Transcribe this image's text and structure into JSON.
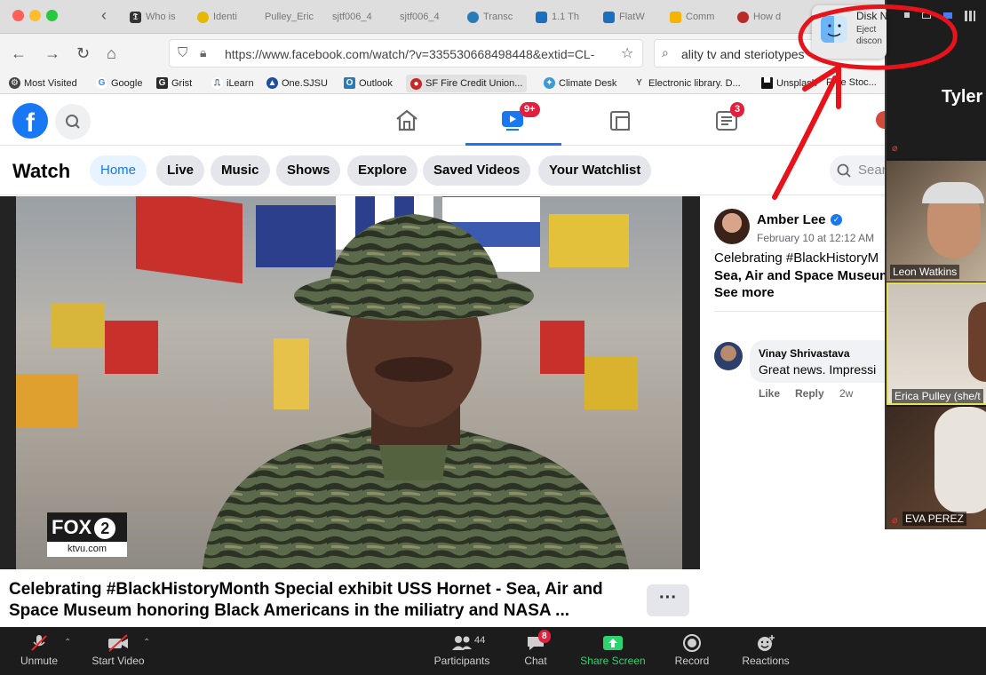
{
  "browser": {
    "tabs": [
      {
        "label": "Who is",
        "icon": "nyt-icon",
        "color": "#333333"
      },
      {
        "label": "Identi",
        "icon": "circle-logo-icon",
        "color": "#e6b800"
      },
      {
        "label": "Pulley_Eric",
        "icon": "doc-icon",
        "color": "#7a5cc6"
      },
      {
        "label": "sjtf006_4",
        "icon": "doc-icon",
        "color": "#888888"
      },
      {
        "label": "sjtf006_4",
        "icon": "doc-icon",
        "color": "#888888"
      },
      {
        "label": "Transc",
        "icon": "swirl-icon",
        "color": "#2a7ab8"
      },
      {
        "label": "1.1 Th",
        "icon": "bird-icon",
        "color": "#1a6fc0"
      },
      {
        "label": "FlatW",
        "icon": "bird-icon",
        "color": "#1a6fc0"
      },
      {
        "label": "Comm",
        "icon": "slides-icon",
        "color": "#f4b400"
      },
      {
        "label": "How d",
        "icon": "quora-icon",
        "color": "#b92b27"
      }
    ],
    "url": "https://www.facebook.com/watch/?v=335530668498448&extid=CL-",
    "search_value": "ality tv and steriotypes",
    "bookmarks": [
      {
        "label": "Most Visited",
        "icon": "gear-icon",
        "color": "#444444"
      },
      {
        "label": "Google",
        "icon": "google-icon",
        "color": "#4285f4"
      },
      {
        "label": "Grist",
        "icon": "grist-icon",
        "color": "#2b2b2b"
      },
      {
        "label": "iLearn",
        "icon": "ilearn-icon",
        "color": "#1f4e9c"
      },
      {
        "label": "One.SJSU",
        "icon": "sjsu-icon",
        "color": "#1f4e9c"
      },
      {
        "label": "Outlook",
        "icon": "outlook-icon",
        "color": "#2a7ab8"
      },
      {
        "label": "SF Fire Credit Union...",
        "icon": "credit-union-icon",
        "color": "#c62828"
      },
      {
        "label": "Climate Desk",
        "icon": "climate-icon",
        "color": "#3a9bd9"
      },
      {
        "label": "Electronic library. D...",
        "icon": "library-icon",
        "color": "#555555"
      },
      {
        "label": "Unsplash",
        "icon": "unsplash-icon",
        "color": "#111111"
      },
      {
        "label": "Free Stoc...",
        "icon": "",
        "color": "#111111"
      }
    ]
  },
  "facebook": {
    "logo": "f",
    "watch_badge": "9+",
    "news_badge": "3",
    "page_title": "Watch",
    "nav_pills": [
      "Home",
      "Live",
      "Music",
      "Shows",
      "Explore",
      "Saved Videos",
      "Your Watchlist"
    ],
    "search_placeholder": "Sear",
    "video": {
      "logo_text": "FOX",
      "logo_digit": "2",
      "logo_sub": "ktvu.com",
      "caption": "Celebrating #BlackHistoryMonth Special exhibit USS Hornet - Sea, Air and Space Museum honoring Black Americans in the miliatry and NASA ..."
    },
    "post": {
      "author": "Amber Lee",
      "date": "February 10 at 12:12 AM",
      "text_line1": "Celebrating #BlackHistoryM",
      "text_line2": "Sea, Air and Space Museum",
      "see_more": "See more",
      "comment": {
        "author": "Vinay Shrivastava",
        "text": "Great news. Impressi",
        "like": "Like",
        "reply": "Reply",
        "age": "2w"
      }
    }
  },
  "notification": {
    "title": "Disk N",
    "line1": "Eject",
    "line2": "discon"
  },
  "zoom": {
    "speaker_name": "Tyler",
    "participants": [
      {
        "name": "Leon Watkins"
      },
      {
        "name": "Erica Pulley (she/t"
      },
      {
        "name": "EVA PEREZ"
      }
    ],
    "toolbar": {
      "unmute": "Unmute",
      "start_video": "Start Video",
      "participants": "Participants",
      "participants_count": "44",
      "chat": "Chat",
      "chat_badge": "8",
      "share_screen": "Share Screen",
      "record": "Record",
      "reactions": "Reactions"
    },
    "colors": {
      "share_green": "#2dd36f",
      "badge_red": "#e41e3f",
      "mute_red": "#e02f2f"
    }
  },
  "annotation": {
    "color": "#e8131a"
  }
}
